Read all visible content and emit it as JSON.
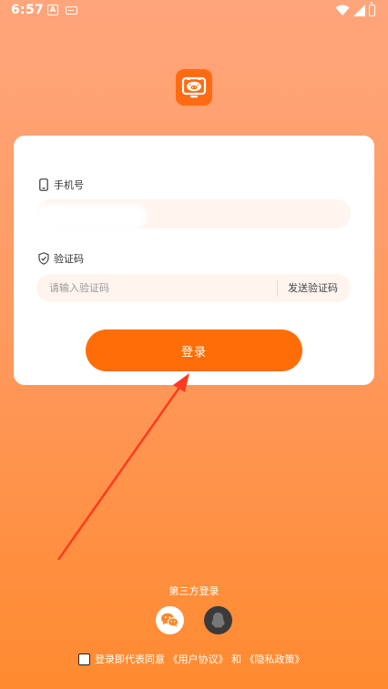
{
  "status_bar": {
    "time": "6:57",
    "notification_letter": "A"
  },
  "login": {
    "phone_label": "手机号",
    "phone_value": "",
    "code_label": "验证码",
    "code_placeholder": "请输入验证码",
    "send_code_label": "发送验证码",
    "login_button_label": "登录"
  },
  "third_party": {
    "title": "第三方登录",
    "options": [
      {
        "icon": "wechat-icon"
      },
      {
        "icon": "qq-icon"
      }
    ]
  },
  "agreement": {
    "prefix": "登录即代表同意",
    "user_agreement": "《用户协议》",
    "and_text": "和",
    "privacy_policy": "《隐私政策》",
    "checked": false
  },
  "colors": {
    "accent": "#ff6d09",
    "logo": "#ff6b12",
    "background_top": "#ffa57b",
    "background_bottom": "#ff8a2f",
    "annotation_arrow": "#ff3b1f"
  }
}
